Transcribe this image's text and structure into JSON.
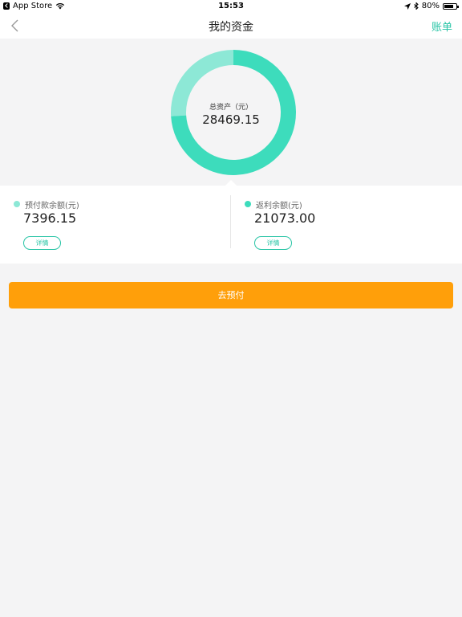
{
  "status_bar": {
    "app_back_label": "App Store",
    "time": "15:53",
    "battery": "80%"
  },
  "nav": {
    "title": "我的资金",
    "bill_label": "账单"
  },
  "summary": {
    "total_label": "总资产（元）",
    "total_value": "28469.15",
    "segments": [
      {
        "name": "预付款余额",
        "value": 7396.15,
        "color": "#8de8d6"
      },
      {
        "name": "返利余额",
        "value": 21073.0,
        "color": "#3ddcbc"
      }
    ]
  },
  "accounts": [
    {
      "label": "预付款余额(元)",
      "amount": "7396.15",
      "button": "详情",
      "dot_color": "#8de8d6"
    },
    {
      "label": "返利余额(元)",
      "amount": "21073.00",
      "button": "详情",
      "dot_color": "#3ddcbc"
    }
  ],
  "action": {
    "prepay_label": "去预付",
    "color": "#ff9f0a"
  },
  "colors": {
    "accent": "#27c4a5",
    "background": "#f4f4f5"
  }
}
